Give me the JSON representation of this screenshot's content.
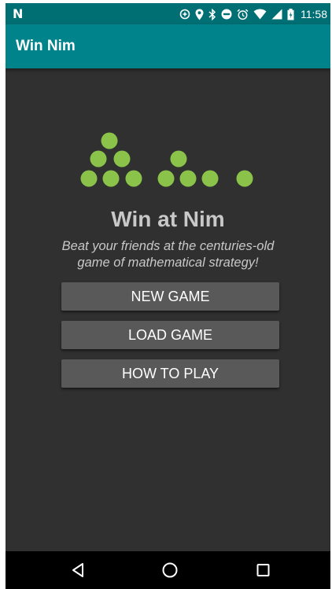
{
  "status_bar": {
    "brand": "N",
    "time": "11:58",
    "icons": [
      "data-saver-icon",
      "location-icon",
      "bluetooth-icon",
      "do-not-disturb-icon",
      "alarm-icon",
      "wifi-icon",
      "signal-icon",
      "battery-icon"
    ]
  },
  "app_bar": {
    "title": "Win Nim"
  },
  "main": {
    "headline": "Win at Nim",
    "tagline": "Beat your friends at the centuries-old game of mathematical strategy!",
    "buttons": {
      "new_game": "NEW GAME",
      "load_game": "LOAD GAME",
      "how_to_play": "HOW TO PLAY"
    }
  },
  "nav_bar": {
    "icons": [
      "back-icon",
      "home-icon",
      "recents-icon"
    ]
  },
  "colors": {
    "status_bar": "#006f74",
    "app_bar": "#00838a",
    "background": "#303030",
    "button": "#595959",
    "logo_dot": "#8bc34a",
    "text": "#c8c8c8"
  }
}
